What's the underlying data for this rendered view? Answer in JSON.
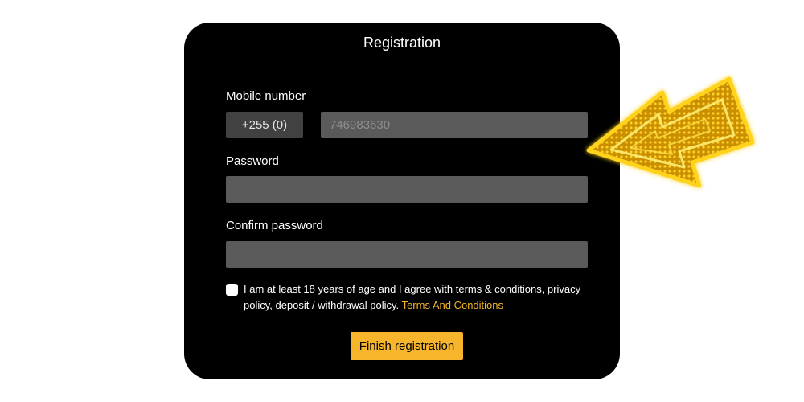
{
  "form": {
    "title": "Registration",
    "mobile_label": "Mobile number",
    "country_code": "+255 (0)",
    "phone_placeholder": "746983630",
    "password_label": "Password",
    "confirm_label": "Confirm password",
    "terms_text": "I am at least 18 years of age and I agree with terms & conditions, privacy policy, deposit / withdrawal policy.",
    "terms_link": "Terms And Conditions",
    "terms_checked": false,
    "submit_label": "Finish registration"
  },
  "decoration": {
    "arrow_icon": "neon-arrow-icon"
  },
  "colors": {
    "card_background": "#000000",
    "input_background": "#5a5a5a",
    "code_background": "#414141",
    "accent": "#f7b52c",
    "link": "#f5b521",
    "arrow_neon": "#ffd21a"
  }
}
